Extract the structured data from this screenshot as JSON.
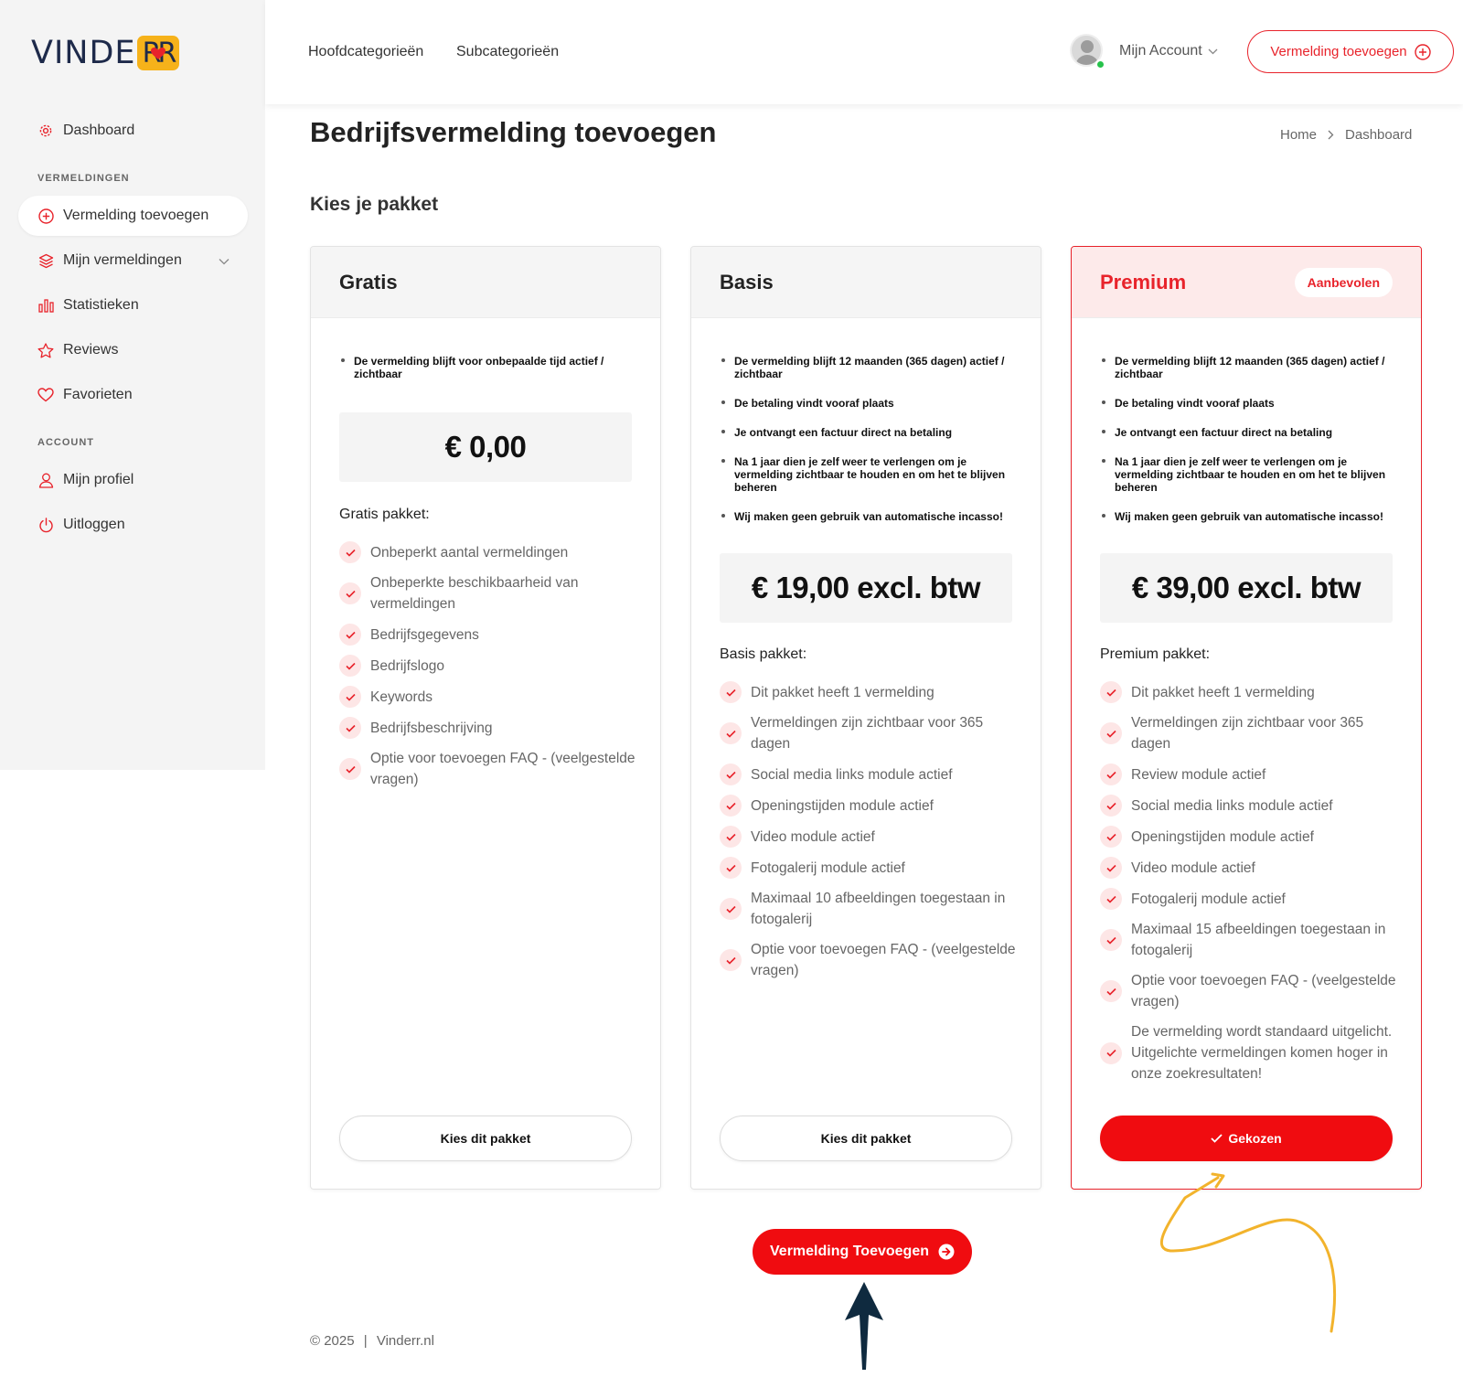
{
  "brand": {
    "name_part1": "VINDE",
    "name_mark": "RR"
  },
  "sidebar": {
    "dashboard": "Dashboard",
    "section_listings": "VERMELDINGEN",
    "add_listing": "Vermelding toevoegen",
    "my_listings": "Mijn vermeldingen",
    "statistics": "Statistieken",
    "reviews": "Reviews",
    "favorites": "Favorieten",
    "section_account": "ACCOUNT",
    "my_profile": "Mijn profiel",
    "logout": "Uitloggen"
  },
  "topbar": {
    "main_categories": "Hoofdcategorieën",
    "subcategories": "Subcategorieën",
    "account": "Mijn Account",
    "cta": "Vermelding toevoegen"
  },
  "page": {
    "title": "Bedrijfsvermelding toevoegen",
    "breadcrumb": [
      "Home",
      "Dashboard"
    ],
    "section": "Kies je pakket"
  },
  "plans": [
    {
      "name": "Gratis",
      "intro": [
        "De vermelding blijft voor onbepaalde tijd actief / zichtbaar"
      ],
      "price": "€ 0,00",
      "package_title": "Gratis pakket:",
      "features": [
        "Onbeperkt aantal vermeldingen",
        "Onbeperkte beschikbaarheid van vermeldingen",
        "Bedrijfsgegevens",
        "Bedrijfslogo",
        "Keywords",
        "Bedrijfsbeschrijving",
        "Optie voor toevoegen FAQ - (veelgestelde vragen)"
      ],
      "button": "Kies dit pakket"
    },
    {
      "name": "Basis",
      "intro": [
        "De vermelding blijft 12 maanden (365 dagen) actief / zichtbaar",
        "De betaling vindt vooraf plaats",
        "Je ontvangt een factuur direct na betaling",
        "Na 1 jaar dien je zelf weer te verlengen om je vermelding zichtbaar te houden en om het te blijven beheren",
        "Wij maken geen gebruik van automatische incasso!"
      ],
      "price": "€ 19,00 excl. btw",
      "package_title": "Basis pakket:",
      "features": [
        "Dit pakket heeft 1 vermelding",
        "Vermeldingen zijn zichtbaar voor 365 dagen",
        "Social media links module actief",
        "Openingstijden module actief",
        "Video module actief",
        "Fotogalerij module actief",
        "Maximaal 10 afbeeldingen toegestaan in fotogalerij",
        "Optie voor toevoegen FAQ - (veelgestelde vragen)"
      ],
      "button": "Kies dit pakket"
    },
    {
      "name": "Premium",
      "badge": "Aanbevolen",
      "intro": [
        "De vermelding blijft 12 maanden (365 dagen) actief / zichtbaar",
        "De betaling vindt vooraf plaats",
        "Je ontvangt een factuur direct na betaling",
        "Na 1 jaar dien je zelf weer te verlengen om je vermelding zichtbaar te houden en om het te blijven beheren",
        "Wij maken geen gebruik van automatische incasso!"
      ],
      "price": "€ 39,00 excl. btw",
      "package_title": "Premium pakket:",
      "features": [
        "Dit pakket heeft 1 vermelding",
        "Vermeldingen zijn zichtbaar voor 365 dagen",
        "Review module actief",
        "Social media links module actief",
        "Openingstijden module actief",
        "Video module actief",
        "Fotogalerij module actief",
        "Maximaal 15 afbeeldingen toegestaan in fotogalerij",
        "Optie voor toevoegen FAQ - (veelgestelde vragen)",
        "De vermelding wordt standaard uitgelicht. Uitgelichte vermeldingen komen hoger in onze zoekresultaten!"
      ],
      "button": "Gekozen"
    }
  ],
  "main_cta": "Vermelding Toevoegen",
  "footer": {
    "year": "© 2025",
    "separator": "|",
    "site": "Vinderr.nl"
  },
  "colors": {
    "accent": "#f00c10",
    "accent_light": "#fdeaea",
    "brand_dark": "#1e2a4a",
    "brand_yellow": "#f6b21a",
    "annotation_yellow": "#f2b32c",
    "annotation_navy": "#0f2a3f"
  }
}
